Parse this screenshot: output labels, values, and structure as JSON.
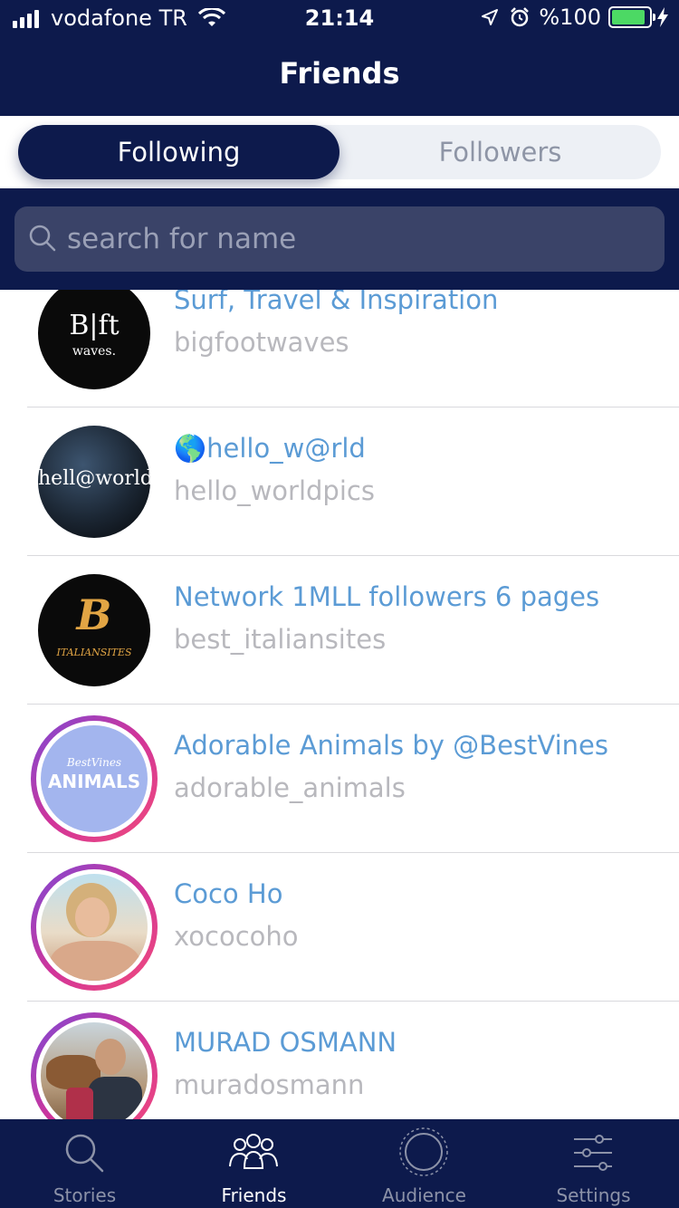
{
  "status_bar": {
    "carrier": "vodafone TR",
    "time": "21:14",
    "battery": "%100"
  },
  "nav": {
    "title": "Friends"
  },
  "segment": {
    "active": "Following",
    "inactive": "Followers"
  },
  "search": {
    "placeholder": "search for name"
  },
  "friends": [
    {
      "name": "Surf, Travel & Inspiration",
      "handle": "bigfootwaves",
      "avatar_text_1": "B|ft",
      "avatar_text_2": "waves."
    },
    {
      "name": "🌎hello_w@rld",
      "handle": "hello_worldpics",
      "avatar_text_1": "hell@world"
    },
    {
      "name": "Network 1MLL followers 6 pages",
      "handle": "best_italiansites",
      "avatar_text_1": "B",
      "avatar_text_2": "ITALIANSITES"
    },
    {
      "name": "Adorable Animals by @BestVines",
      "handle": "adorable_animals",
      "avatar_text_1": "BestVines",
      "avatar_text_2": "ANIMALS"
    },
    {
      "name": "Coco Ho",
      "handle": "xococoho"
    },
    {
      "name": "MURAD OSMANN",
      "handle": "muradosmann"
    }
  ],
  "tabs": [
    {
      "label": "Stories",
      "icon": "search-icon"
    },
    {
      "label": "Friends",
      "icon": "people-icon"
    },
    {
      "label": "Audience",
      "icon": "circle-icon"
    },
    {
      "label": "Settings",
      "icon": "sliders-icon"
    }
  ],
  "colors": {
    "navy": "#0d1a4c",
    "link": "#5b9bd5",
    "muted": "#b8b8bd"
  }
}
